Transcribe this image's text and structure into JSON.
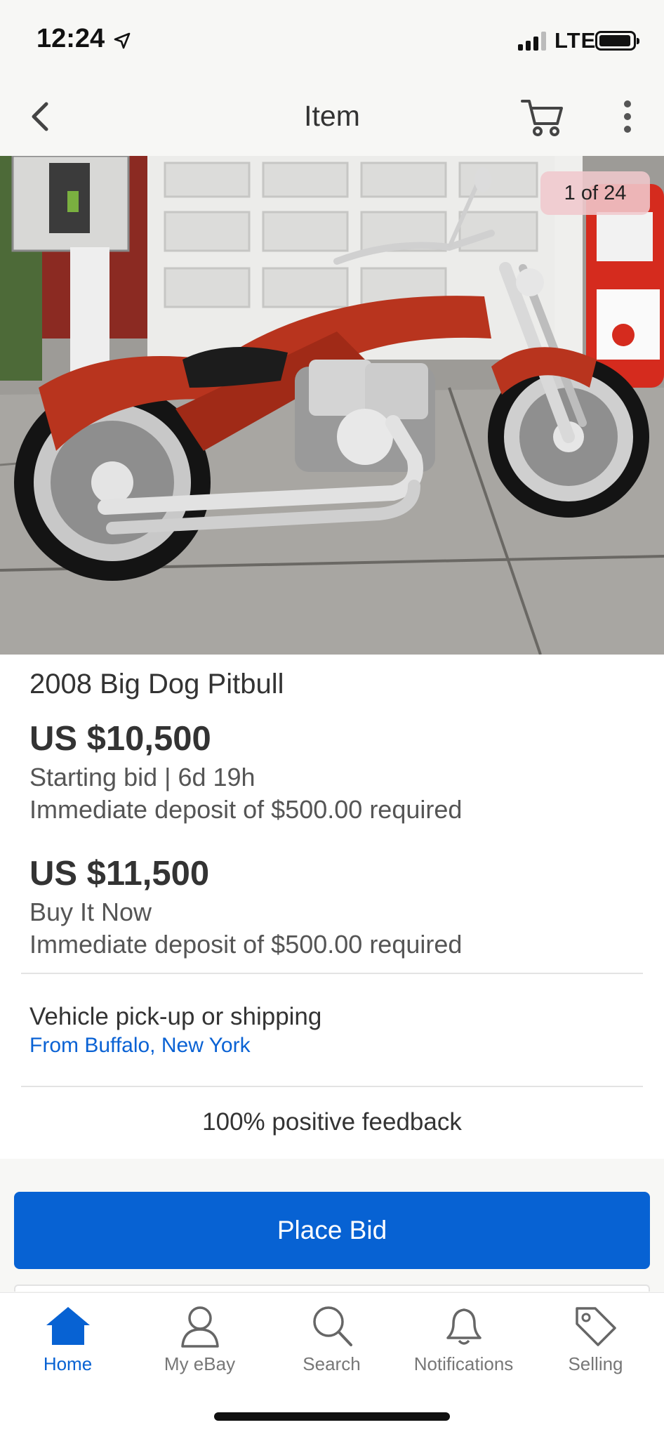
{
  "status_bar": {
    "time": "12:24",
    "carrier": "LTE"
  },
  "nav": {
    "title": "Item"
  },
  "gallery": {
    "counter": "1 of 24"
  },
  "item": {
    "title": "2008 Big Dog Pitbull",
    "starting_price": "US $10,500",
    "starting_info": "Starting bid | 6d 19h",
    "starting_deposit": "Immediate deposit of $500.00 required",
    "bin_price": "US $11,500",
    "bin_label": "Buy It Now",
    "bin_deposit": "Immediate deposit of $500.00 required"
  },
  "shipping": {
    "title": "Vehicle pick-up or shipping",
    "location": "From Buffalo, New York"
  },
  "seller": {
    "feedback": "100% positive feedback"
  },
  "actions": {
    "place_bid": "Place Bid"
  },
  "tabs": [
    {
      "label": "Home",
      "icon": "home-icon",
      "active": true
    },
    {
      "label": "My eBay",
      "icon": "person-icon",
      "active": false
    },
    {
      "label": "Search",
      "icon": "search-icon",
      "active": false
    },
    {
      "label": "Notifications",
      "icon": "bell-icon",
      "active": false
    },
    {
      "label": "Selling",
      "icon": "tag-icon",
      "active": false
    }
  ],
  "colors": {
    "accent": "#0762d3",
    "link": "#0a62d4",
    "bike_red": "#b8341e"
  }
}
